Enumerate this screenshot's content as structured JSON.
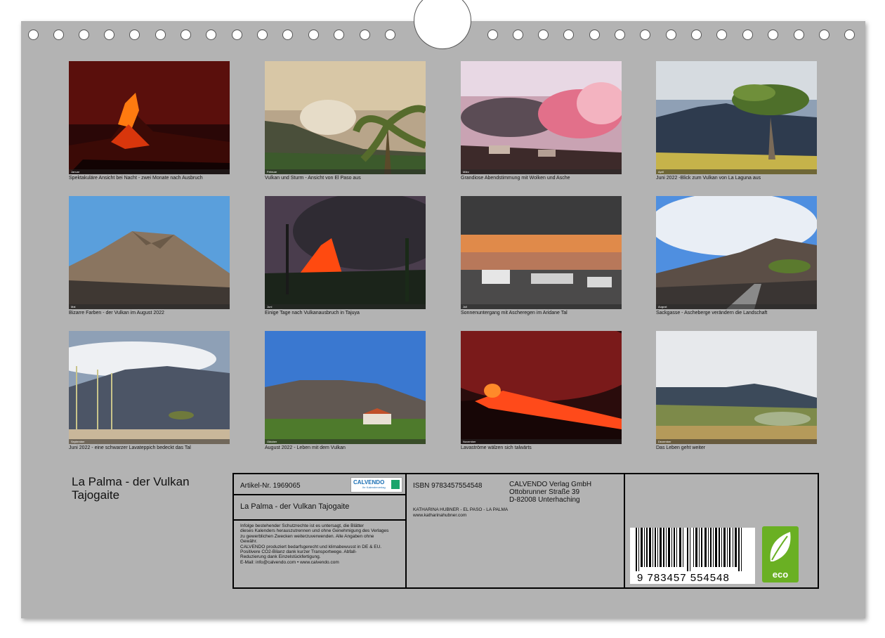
{
  "photos": [
    {
      "caption": "Spektakuläre Ansicht bei Nacht - zwei Monate nach Ausbruch",
      "month": "Januar"
    },
    {
      "caption": "Vulkan und Sturm - Ansicht von El Paso aus",
      "month": "Februar"
    },
    {
      "caption": "Grandiose Abendstimmung mit Wolken und Asche",
      "month": "März"
    },
    {
      "caption": "Juni 2022 -Blick zum Vulkan von La Laguna aus",
      "month": "April"
    },
    {
      "caption": "Bizarre Farben - der Vulkan im August 2022",
      "month": "Mai"
    },
    {
      "caption": "Einige Tage nach Vulkanausbruch in Tajuya",
      "month": "Juni"
    },
    {
      "caption": "Sonnenuntergang mit Ascheregen im Aridane Tal",
      "month": "Juli"
    },
    {
      "caption": "Sackgasse - Ascheberge verändern die Landschaft",
      "month": "August"
    },
    {
      "caption": "Juni 2022 - eine schwarzer Lavateppich bedeckt das Tal",
      "month": "September"
    },
    {
      "caption": "August 2022 - Leben mit dem Vulkan",
      "month": "Oktober"
    },
    {
      "caption": "Lavaströme wälzen sich talwärts",
      "month": "November"
    },
    {
      "caption": "Das Leben geht weiter",
      "month": "Dezember"
    }
  ],
  "title": {
    "line1": "La Palma - der Vulkan",
    "line2": "Tajogaite"
  },
  "info": {
    "article": "Artikel-Nr. 1969065",
    "logo_name": "CALVENDO",
    "logo_sub": "Ihr Kalenderverlag",
    "product_title": "La Palma - der Vulkan Tajogaite",
    "legal": [
      "Infolge bestehender Schutzrechte ist es untersagt, die Blätter",
      "dieses Kalenders herauszutrennen und ohne Genehmigung des Verlages",
      "zu gewerblichen Zwecken weiterzuverwenden. Alle Angaben ohne",
      "Gewähr.",
      "CALVENDO produziert bedarfsgerecht und klimabewusst in DE & EU.",
      "Positivere CO2-Bilanz dank kurzer Transportwege. Abfall-",
      "Reduzierung dank Einzelstückfertigung.",
      "E-Mail: info@calvendo.com • www.calvendo.com"
    ],
    "isbn": "ISBN 9783457554548",
    "publisher": [
      "CALVENDO Verlag GmbH",
      "Ottobrunner Straße 39",
      "D-82008 Unterhaching"
    ],
    "author": "KATHARINA HUBNER - EL PASO - LA PALMA",
    "website": "www.katharinahubner.com",
    "barcode_number": "9  783457  554548",
    "eco_label": "eco"
  }
}
